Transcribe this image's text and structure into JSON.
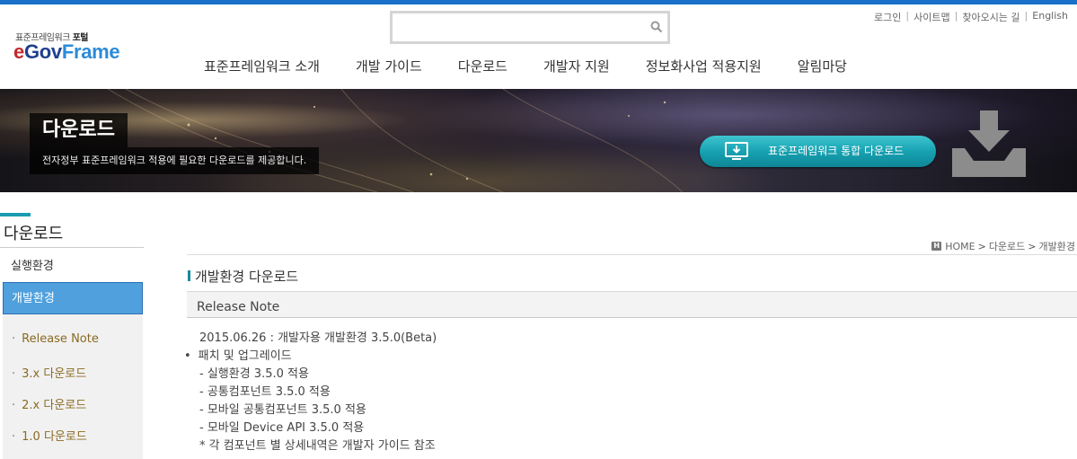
{
  "header": {
    "logo_sub": "표준프레임워크",
    "logo_sub_bold": "포털",
    "logo_e": "e",
    "logo_gov": "Gov",
    "logo_frame": "Frame",
    "search_placeholder": "",
    "util_links": [
      "로그인",
      "사이트맵",
      "찾아오시는 길",
      "English"
    ],
    "gnb": [
      "표준프레임워크 소개",
      "개발 가이드",
      "다운로드",
      "개발자 지원",
      "정보화사업 적용지원",
      "알림마당"
    ]
  },
  "banner": {
    "title": "다운로드",
    "description": "전자정부 표준프레임워크 적용에 필요한 다운로드를 제공합니다.",
    "button_label": "표준프레임워크  통합 다운로드"
  },
  "sidebar": {
    "title": "다운로드",
    "items": [
      "실행환경",
      "개발환경"
    ],
    "active_index": 1,
    "sub_items": [
      "Release Note",
      "3.x 다운로드",
      "2.x 다운로드",
      "1.0 다운로드"
    ],
    "sub_bullet": "·"
  },
  "breadcrumb": {
    "home": "HOME",
    "path": [
      "다운로드",
      "개발환경"
    ]
  },
  "content": {
    "page_title": "개발환경 다운로드",
    "section_title": "Release Note",
    "release_lines": [
      "2015.06.26 : 개발자용 개발환경 3.5.0(Beta)",
      "패치 및 업그레이드",
      "- 실행환경 3.5.0 적용",
      "- 공통컴포넌트 3.5.0 적용",
      "- 모바일 공통컴포넌트 3.5.0 적용",
      "- 모바일 Device API 3.5.0 적용",
      "* 각 컴포넌트 별 상세내역은 개발자 가이드 참조"
    ]
  },
  "colors": {
    "top_bar": "#1a6fc9",
    "active_nav": "#4fa0dd",
    "teal_button": "#17a2b2",
    "sub_item_text": "#8b6a22"
  }
}
